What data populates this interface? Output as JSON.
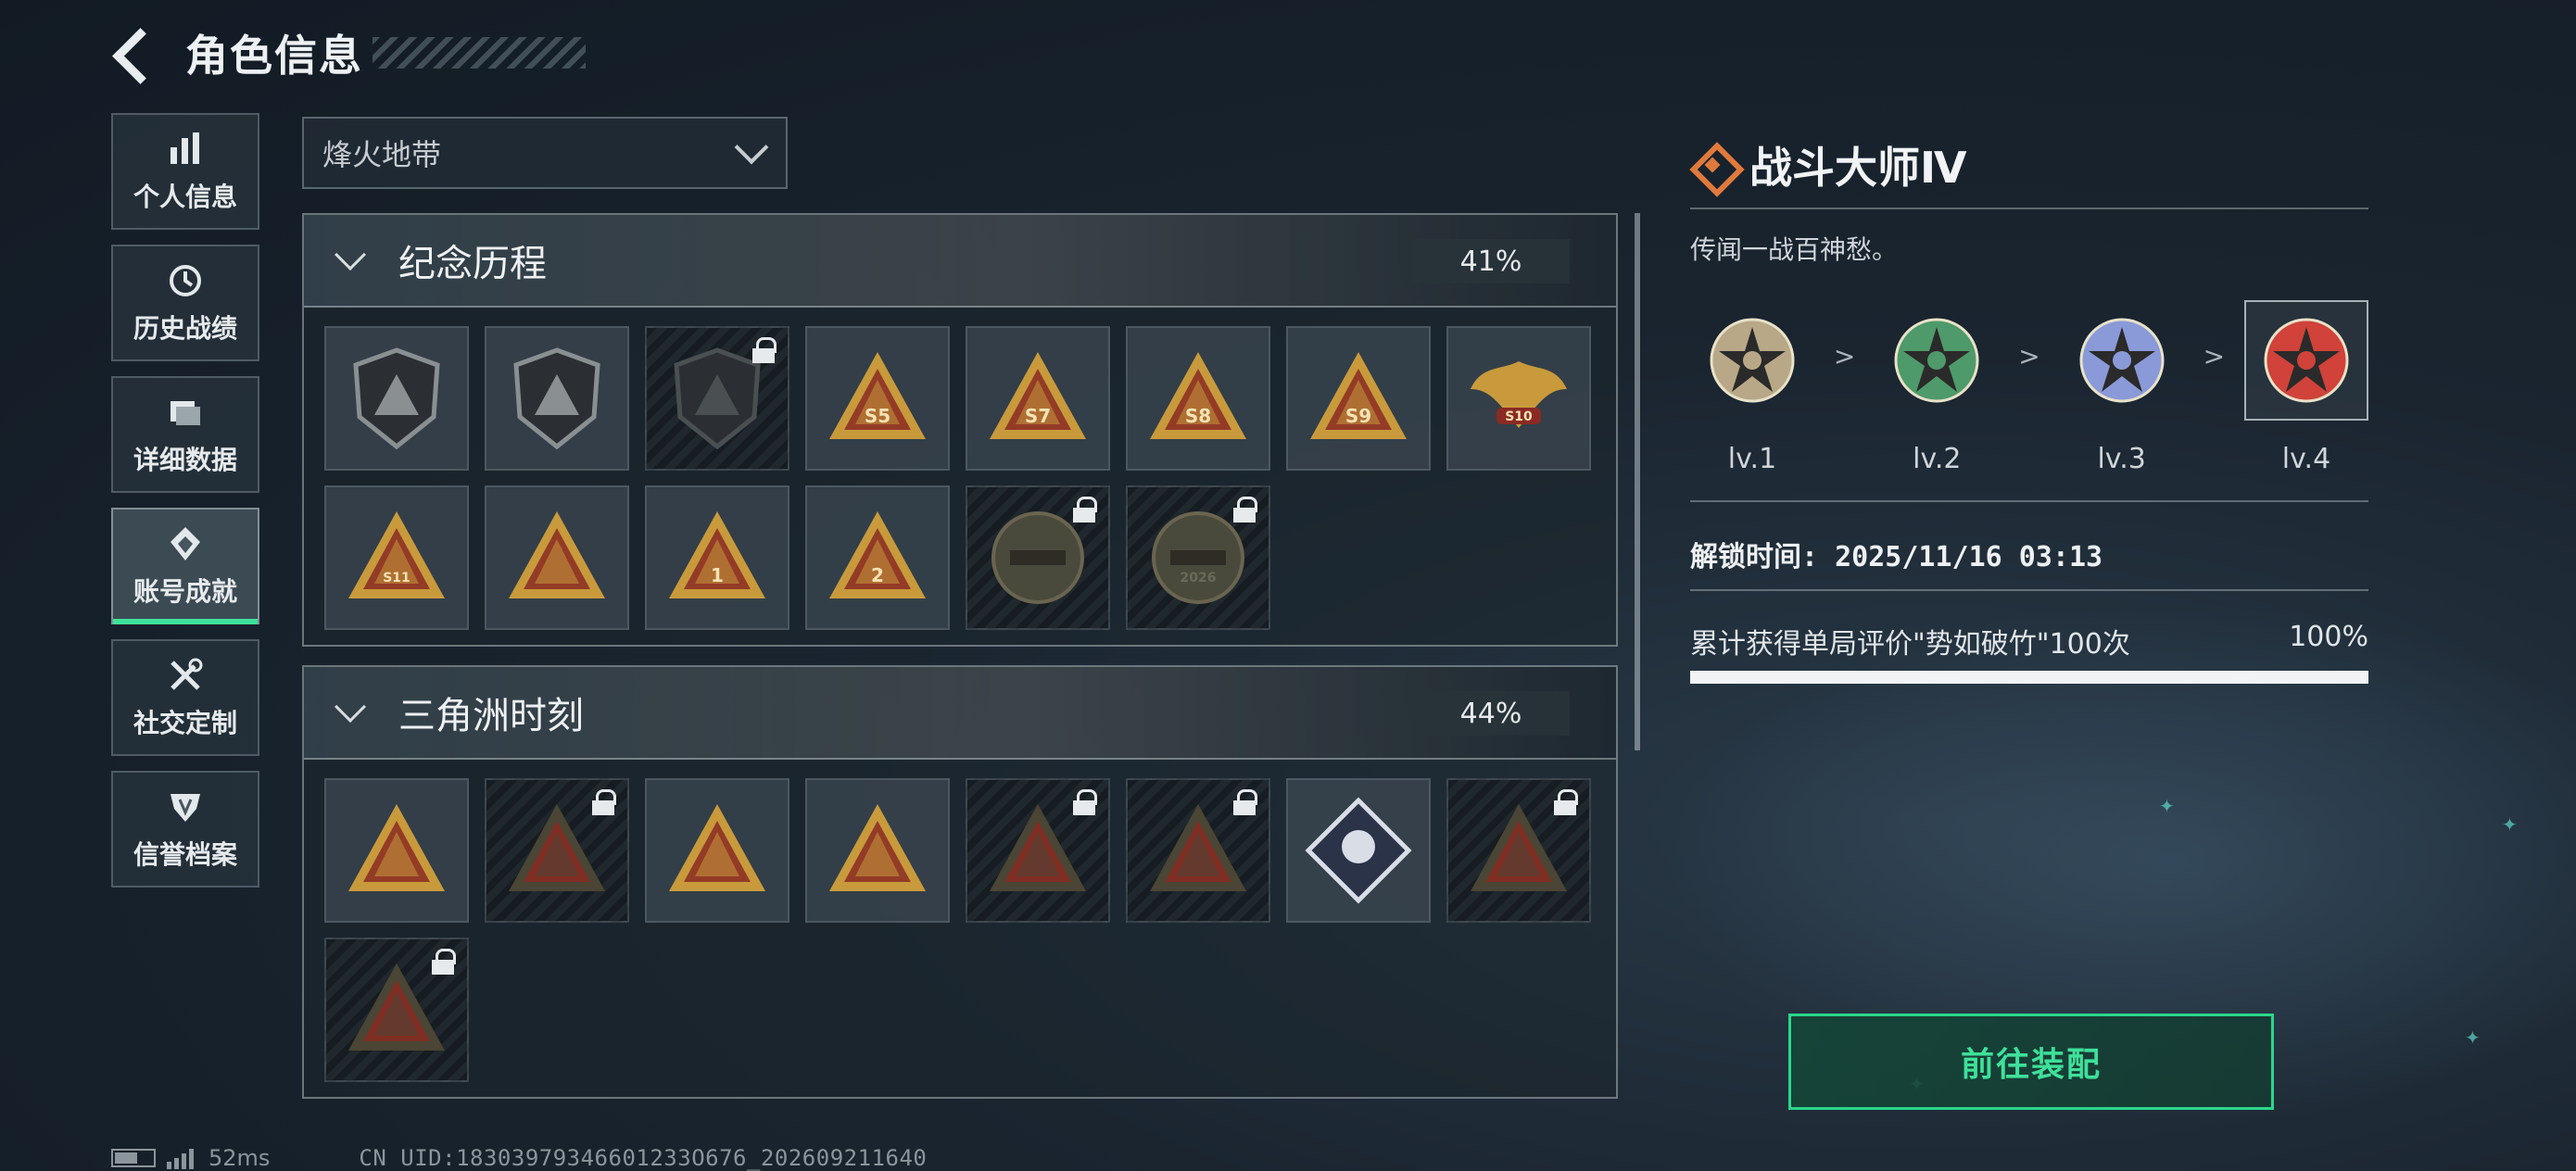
{
  "header": {
    "title": "角色信息"
  },
  "sidebar": {
    "items": [
      {
        "label": "个人信息",
        "icon": "bar-chart-icon",
        "active": false
      },
      {
        "label": "历史战绩",
        "icon": "history-icon",
        "active": false
      },
      {
        "label": "详细数据",
        "icon": "folder-icon",
        "active": false
      },
      {
        "label": "账号成就",
        "icon": "achievement-icon",
        "active": true
      },
      {
        "label": "社交定制",
        "icon": "tools-icon",
        "active": false
      },
      {
        "label": "信誉档案",
        "icon": "credit-icon",
        "active": false
      }
    ]
  },
  "filter": {
    "selected": "烽火地带"
  },
  "sections": [
    {
      "title": "纪念历程",
      "percent": "41%",
      "badges": [
        {
          "label": "",
          "locked": false,
          "shape": "shield",
          "color": "#8a8f92"
        },
        {
          "label": "",
          "locked": false,
          "shape": "shield",
          "color": "#8a8f92"
        },
        {
          "label": "",
          "locked": true,
          "shape": "shield",
          "color": "#4a4f52"
        },
        {
          "label": "S5",
          "locked": false,
          "shape": "triangle",
          "color": "#c89a3c"
        },
        {
          "label": "S7",
          "locked": false,
          "shape": "triangle",
          "color": "#c89a3c"
        },
        {
          "label": "S8",
          "locked": false,
          "shape": "triangle",
          "color": "#c89a3c"
        },
        {
          "label": "S9",
          "locked": false,
          "shape": "triangle",
          "color": "#c89a3c"
        },
        {
          "label": "S10",
          "locked": false,
          "shape": "wings",
          "color": "#c89a3c"
        },
        {
          "label": "S11",
          "locked": false,
          "shape": "triangle",
          "color": "#c89a3c"
        },
        {
          "label": "",
          "locked": false,
          "shape": "triangle",
          "color": "#c89a3c"
        },
        {
          "label": "1",
          "locked": false,
          "shape": "triangle",
          "color": "#c89a3c"
        },
        {
          "label": "2",
          "locked": false,
          "shape": "triangle",
          "color": "#c89a3c"
        },
        {
          "label": "",
          "locked": true,
          "shape": "round",
          "color": "#4a4a3c"
        },
        {
          "label": "2026",
          "locked": true,
          "shape": "round",
          "color": "#4a4a3c"
        }
      ]
    },
    {
      "title": "三角洲时刻",
      "percent": "44%",
      "badges": [
        {
          "label": "",
          "locked": false,
          "shape": "triangle",
          "color": "#c89a3c"
        },
        {
          "label": "",
          "locked": true,
          "shape": "triangle",
          "color": "#4a4534"
        },
        {
          "label": "",
          "locked": false,
          "shape": "triangle",
          "color": "#c89a3c"
        },
        {
          "label": "",
          "locked": false,
          "shape": "triangle",
          "color": "#c89a3c"
        },
        {
          "label": "",
          "locked": true,
          "shape": "triangle",
          "color": "#4a4534"
        },
        {
          "label": "",
          "locked": true,
          "shape": "triangle",
          "color": "#4a4534"
        },
        {
          "label": "",
          "locked": false,
          "shape": "diamond",
          "color": "#d8dde6"
        },
        {
          "label": "",
          "locked": true,
          "shape": "triangle",
          "color": "#4a4534"
        },
        {
          "label": "",
          "locked": true,
          "shape": "triangle",
          "color": "#4a4534"
        }
      ]
    }
  ],
  "detail": {
    "title": "战斗大师Ⅳ",
    "description": "传闻一战百神愁。",
    "levels": [
      {
        "label": "lv.1",
        "color": "#b8a888",
        "current": false
      },
      {
        "label": "lv.2",
        "color": "#4e9a6a",
        "current": false
      },
      {
        "label": "lv.3",
        "color": "#8a9ad8",
        "current": false
      },
      {
        "label": "lv.4",
        "color": "#d0423a",
        "current": true
      }
    ],
    "level_separator": ">",
    "unlock_time": "解锁时间: 2025/11/16 03:13",
    "progress_text": "累计获得单局评价\"势如破竹\"100次",
    "progress_percent": "100%",
    "progress_value": 1.0
  },
  "equip_button": {
    "label": "前往装配"
  },
  "footer": {
    "ping": "52ms",
    "uid": "CN UID:18303979346601233O676_202609211640"
  },
  "colors": {
    "accent_green": "#3fe09a",
    "accent_orange": "#e07a3c"
  }
}
